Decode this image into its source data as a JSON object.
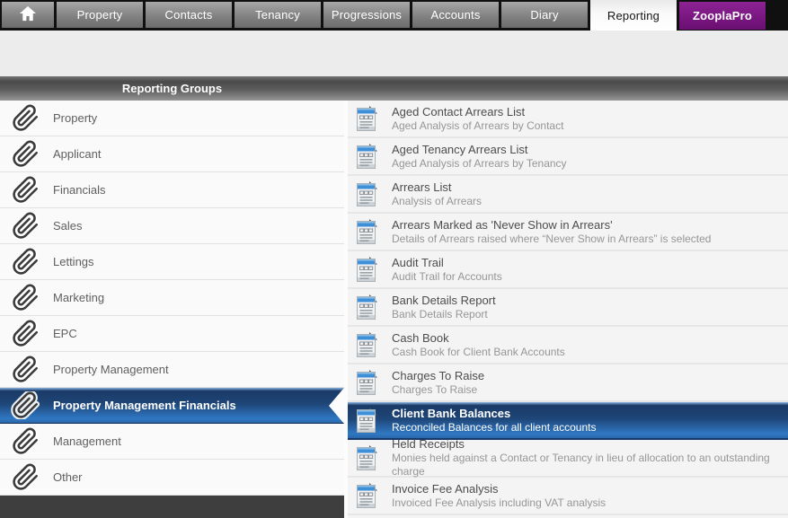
{
  "navbar": {
    "tabs": [
      {
        "label": "",
        "icon": "home-icon",
        "style": "home"
      },
      {
        "label": "Property",
        "style": "default"
      },
      {
        "label": "Contacts",
        "style": "default"
      },
      {
        "label": "Tenancy",
        "style": "default"
      },
      {
        "label": "Progressions",
        "style": "default"
      },
      {
        "label": "Accounts",
        "style": "default"
      },
      {
        "label": "Diary",
        "style": "default"
      },
      {
        "label": "Reporting",
        "style": "active"
      },
      {
        "label": "ZooplaPro",
        "style": "brand"
      }
    ]
  },
  "groups_panel": {
    "header": "Reporting Groups",
    "selected_index": 8,
    "items": [
      {
        "label": "Property"
      },
      {
        "label": "Applicant"
      },
      {
        "label": "Financials"
      },
      {
        "label": "Sales"
      },
      {
        "label": "Lettings"
      },
      {
        "label": "Marketing"
      },
      {
        "label": "EPC"
      },
      {
        "label": "Property Management"
      },
      {
        "label": "Property Management Financials"
      },
      {
        "label": "Management"
      },
      {
        "label": "Other"
      }
    ]
  },
  "reports_panel": {
    "selected_index": 8,
    "items": [
      {
        "title": "Aged Contact Arrears List",
        "description": "Aged Analysis of Arrears by Contact"
      },
      {
        "title": "Aged Tenancy Arrears List",
        "description": "Aged Analysis of Arrears by Tenancy"
      },
      {
        "title": "Arrears List",
        "description": "Analysis of Arrears"
      },
      {
        "title": "Arrears Marked as 'Never Show in Arrears'",
        "description": "Details of Arrears raised where “Never Show in Arrears” is selected"
      },
      {
        "title": "Audit Trail",
        "description": "Audit Trail for Accounts"
      },
      {
        "title": "Bank Details Report",
        "description": "Bank Details Report"
      },
      {
        "title": "Cash Book",
        "description": "Cash Book for Client Bank Accounts"
      },
      {
        "title": "Charges To Raise",
        "description": "Charges To Raise"
      },
      {
        "title": "Client Bank Balances",
        "description": "Reconciled Balances for all client accounts"
      },
      {
        "title": "Held Receipts",
        "description": "Monies held against a Contact or Tenancy in lieu of allocation to an outstanding charge"
      },
      {
        "title": "Invoice Fee Analysis",
        "description": "Invoiced Fee Analysis including VAT analysis"
      }
    ]
  },
  "icons": {
    "group_item": "paperclip-icon",
    "report_item": "report-document-icon",
    "home_tab": "home-icon"
  },
  "colors": {
    "selection_blue_mid": "#2a66a8",
    "selection_blue_dark": "#1a3a66",
    "brand_purple": "#7a1781",
    "nav_black": "#101010",
    "header_gray": "#4a4a4a",
    "panel_footer_gray": "#3e3e3e"
  }
}
